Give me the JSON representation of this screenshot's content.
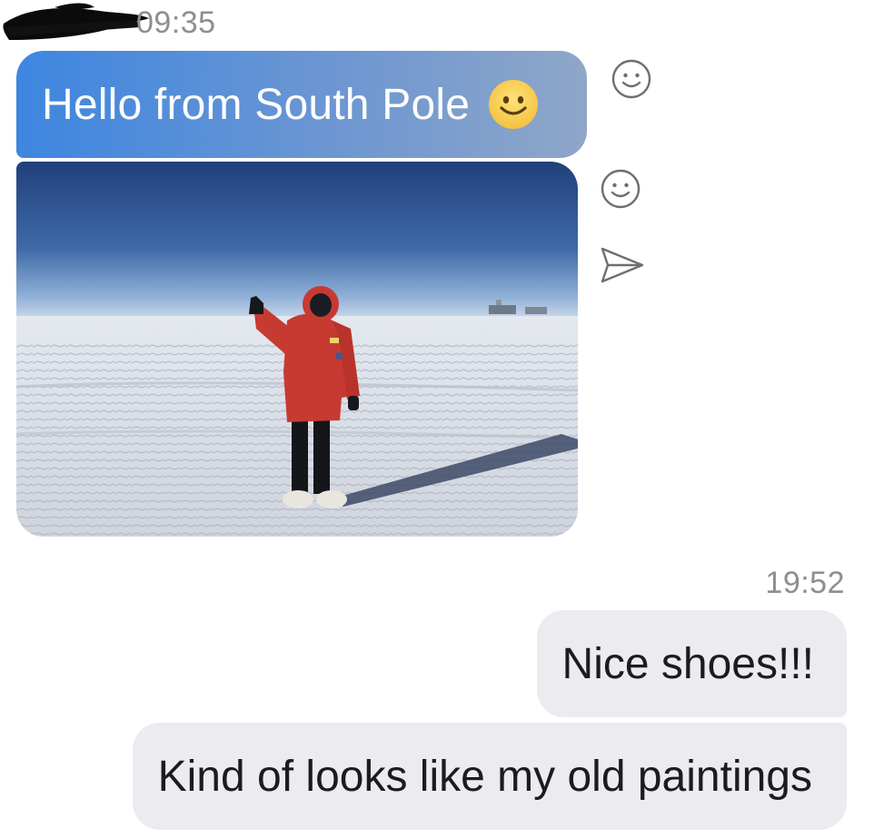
{
  "thread": {
    "top_timestamp": "09:35",
    "incoming": {
      "text_message": "Hello from South Pole",
      "emoji": "slightly-smiling-face",
      "photo_description_icon": "photo"
    },
    "second_timestamp": "19:52",
    "outgoing": [
      {
        "text": "Nice shoes!!!"
      },
      {
        "text": "Kind of looks like my old paintings"
      }
    ]
  },
  "colors": {
    "incoming_bubble_start": "#3d86e0",
    "incoming_bubble_end": "#8fa6c8",
    "outgoing_bubble": "#ebebf0",
    "timestamp": "#8e8e93",
    "emoji_yellow": "#f6c84c"
  },
  "icons": {
    "react": "smiley-outline-icon",
    "share": "paper-plane-icon"
  }
}
